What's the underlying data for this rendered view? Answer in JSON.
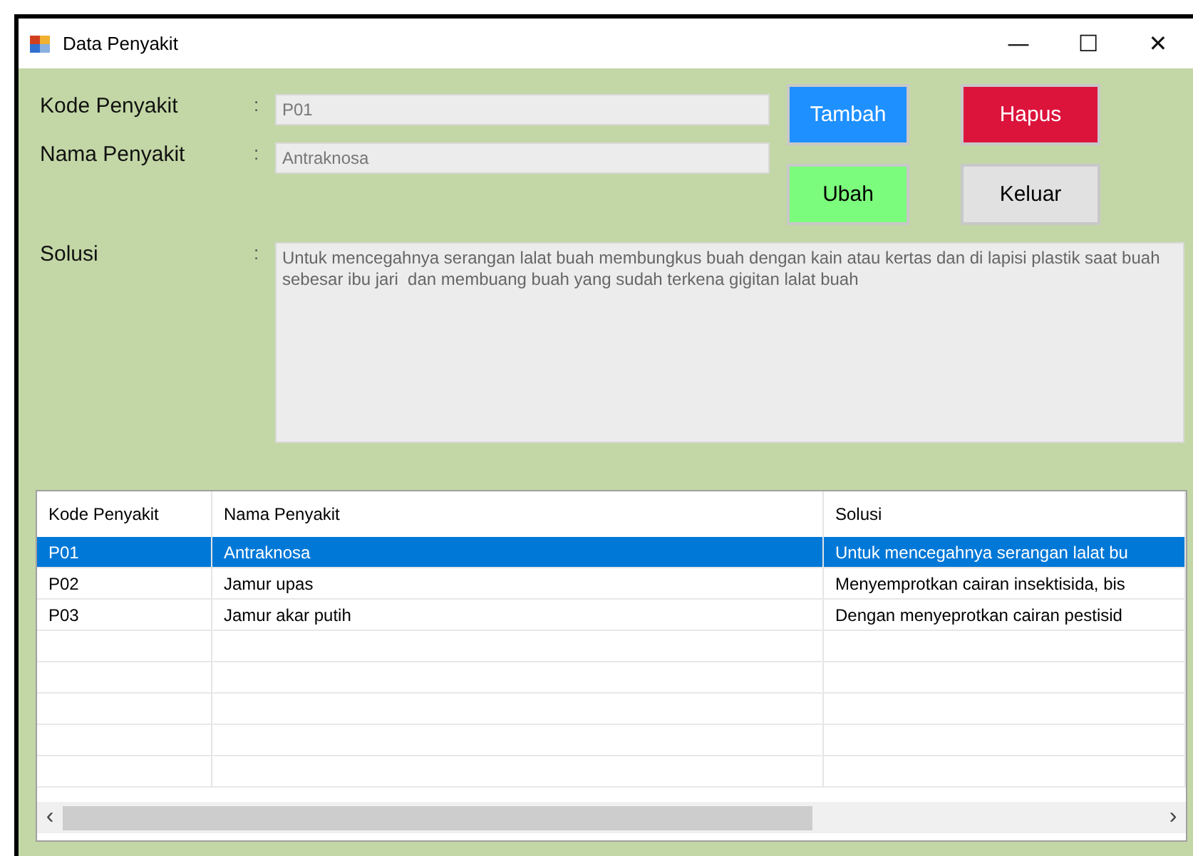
{
  "window": {
    "title": "Data Penyakit",
    "controls": [
      "—",
      "☐",
      "✕"
    ]
  },
  "form": {
    "fields": [
      {
        "label": "Kode Penyakit",
        "separator": ":",
        "value": "P01"
      },
      {
        "label": "Nama Penyakit",
        "separator": ":",
        "value": "Antraknosa"
      }
    ],
    "solusi": {
      "label": "Solusi",
      "separator": ":",
      "value": "Untuk mencegahnya serangan lalat buah membungkus buah dengan kain atau kertas dan di lapisi plastik saat buah sebesar ibu jari  dan membuang buah yang sudah terkena gigitan lalat buah"
    }
  },
  "buttons": [
    {
      "label": "Tambah",
      "color": "#1e90ff"
    },
    {
      "label": "Hapus",
      "color": "#dc143c"
    },
    {
      "label": "Ubah",
      "color": "#7cfc7c"
    },
    {
      "label": "Keluar",
      "color": "#e1e1e1"
    }
  ],
  "table": {
    "columns": [
      "Kode Penyakit",
      "Nama Penyakit",
      "Solusi"
    ],
    "rows": [
      {
        "cells": [
          "P01",
          "Antraknosa",
          "Untuk mencegahnya serangan lalat bu"
        ],
        "selected": true
      },
      {
        "cells": [
          "P02",
          "Jamur upas",
          "Menyemprotkan cairan insektisida, bis"
        ],
        "selected": false
      },
      {
        "cells": [
          "P03",
          "Jamur akar putih",
          "Dengan menyeprotkan cairan  pestisid"
        ],
        "selected": false
      }
    ],
    "scrollbar": {
      "left": "‹",
      "right": "›"
    }
  }
}
